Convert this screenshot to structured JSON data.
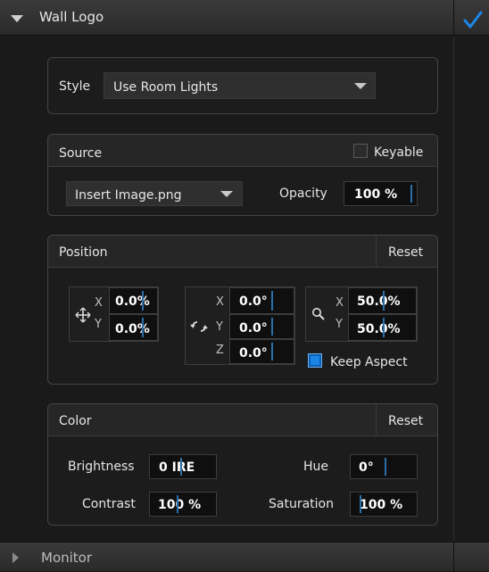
{
  "header": {
    "title": "Wall Logo"
  },
  "style_section": {
    "label": "Style",
    "value": "Use Room Lights"
  },
  "source_section": {
    "title": "Source",
    "keyable_label": "Keyable",
    "image_value": "Insert Image.png",
    "opacity_label": "Opacity",
    "opacity_value": "100 %"
  },
  "position_section": {
    "title": "Position",
    "reset_label": "Reset",
    "move": {
      "x_label": "X",
      "y_label": "Y",
      "x_value": "0.0%",
      "y_value": "0.0%"
    },
    "rotate": {
      "x_label": "X",
      "y_label": "Y",
      "z_label": "Z",
      "x_value": "0.0°",
      "y_value": "0.0°",
      "z_value": "0.0°"
    },
    "scale": {
      "x_label": "X",
      "y_label": "Y",
      "x_value": "50.0%",
      "y_value": "50.0%"
    },
    "keep_aspect_label": "Keep Aspect",
    "keep_aspect_checked": true
  },
  "color_section": {
    "title": "Color",
    "reset_label": "Reset",
    "brightness_label": "Brightness",
    "brightness_value": "0 IRE",
    "hue_label": "Hue",
    "hue_value": "0°",
    "contrast_label": "Contrast",
    "contrast_value": "100 %",
    "saturation_label": "Saturation",
    "saturation_value": "100 %"
  },
  "footer": {
    "title": "Monitor"
  },
  "colors": {
    "accent": "#1a86e8",
    "field_tick": "#2a6fa8"
  }
}
